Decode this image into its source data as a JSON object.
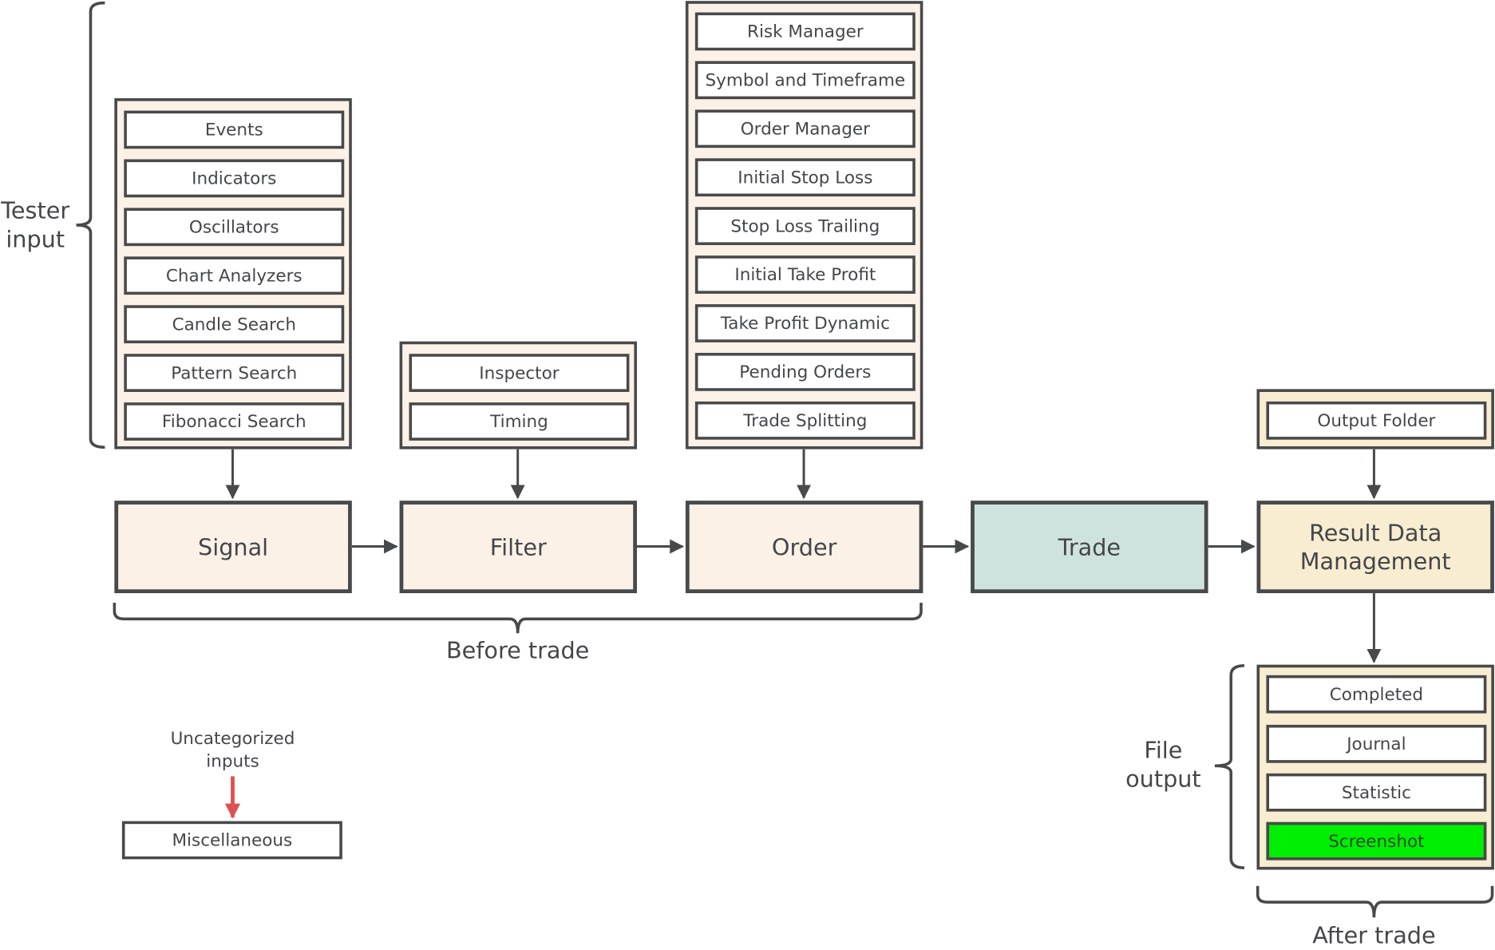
{
  "diagram": {
    "colors": {
      "line": "#48494b",
      "text": "#444649",
      "before_trade_fill": "#fcf1e6",
      "trade_fill": "#cfe3de",
      "after_trade_fill": "#f8ecd1",
      "highlight_fill": "#00ee00",
      "uncategorized_arrow": "#e05050"
    },
    "brackets": {
      "tester_input": "Tester input",
      "before_trade": "Before trade",
      "file_output": "File output",
      "after_trade": "After trade"
    },
    "groups": {
      "signal_inputs": [
        "Events",
        "Indicators",
        "Oscillators",
        "Chart Analyzers",
        "Candle Search",
        "Pattern Search",
        "Fibonacci Search"
      ],
      "filter_inputs": [
        "Inspector",
        "Timing"
      ],
      "order_inputs": [
        "Risk Manager",
        "Symbol and Timeframe",
        "Order Manager",
        "Initial Stop Loss",
        "Stop Loss Trailing",
        "Initial Take Profit",
        "Take Profit Dynamic",
        "Pending Orders",
        "Trade Splitting"
      ],
      "result_inputs": [
        "Output Folder"
      ],
      "file_outputs": [
        {
          "label": "Completed",
          "highlighted": false
        },
        {
          "label": "Journal",
          "highlighted": false
        },
        {
          "label": "Statistic",
          "highlighted": false
        },
        {
          "label": "Screenshot",
          "highlighted": true
        }
      ]
    },
    "stages": [
      {
        "id": "signal",
        "label": "Signal"
      },
      {
        "id": "filter",
        "label": "Filter"
      },
      {
        "id": "order",
        "label": "Order"
      },
      {
        "id": "trade",
        "label": "Trade"
      },
      {
        "id": "result",
        "label": "Result Data Management"
      }
    ],
    "uncategorized": {
      "caption": "Uncategorized inputs",
      "box": "Miscellaneous"
    }
  }
}
